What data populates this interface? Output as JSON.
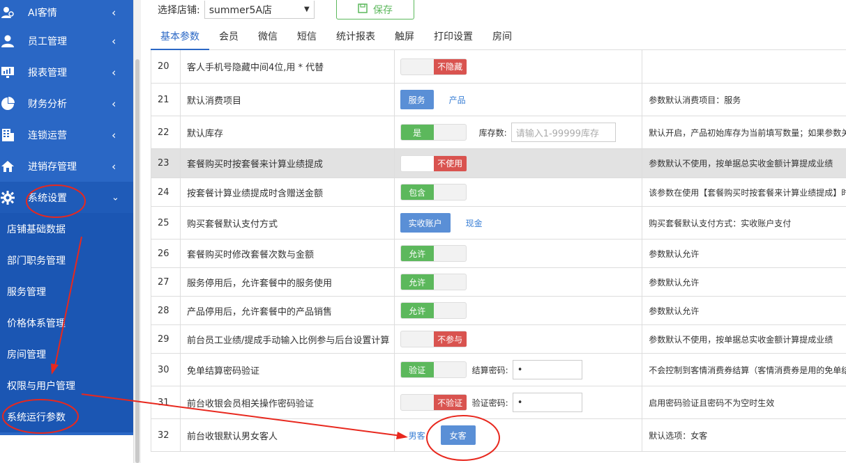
{
  "sidebar": {
    "items": [
      {
        "label": "AI客情",
        "icon": "users-icon"
      },
      {
        "label": "员工管理",
        "icon": "user-icon"
      },
      {
        "label": "报表管理",
        "icon": "monitor-icon"
      },
      {
        "label": "财务分析",
        "icon": "pie-chart-icon"
      },
      {
        "label": "连锁运营",
        "icon": "building-icon"
      },
      {
        "label": "进销存管理",
        "icon": "home-icon"
      },
      {
        "label": "系统设置",
        "icon": "gear-icon"
      }
    ],
    "sub_items": [
      "店铺基础数据",
      "部门职务管理",
      "服务管理",
      "价格体系管理",
      "房间管理",
      "权限与用户管理",
      "系统运行参数"
    ]
  },
  "toolbar": {
    "store_label": "选择店铺:",
    "store_value": "summer5A店",
    "save_label": "保存"
  },
  "tabs": [
    "基本参数",
    "会员",
    "微信",
    "短信",
    "统计报表",
    "触屏",
    "打印设置",
    "房间"
  ],
  "rows": [
    {
      "no": "20",
      "name": "客人手机号隐藏中间4位,用 * 代替",
      "toggle": "不隐藏",
      "desc": ""
    },
    {
      "no": "21",
      "name": "默认消费项目",
      "btn": "服务",
      "link": "产品",
      "desc": "参数默认消费项目：服务"
    },
    {
      "no": "22",
      "name": "默认库存",
      "toggle": "是",
      "field_label": "库存数:",
      "field_placeholder": "请输入1-99999库存",
      "desc": "默认开启，产品初始库存为当前填写数量；如果参数关"
    },
    {
      "no": "23",
      "name": "套餐购买时按套餐来计算业绩提成",
      "toggle": "不使用",
      "desc": "参数默认不使用，按单据总实收金额计算提成业绩"
    },
    {
      "no": "24",
      "name": "按套餐计算业绩提成时含赠送金额",
      "toggle": "包含",
      "desc": "该参数在使用【套餐购买时按套餐来计算业绩提成】时"
    },
    {
      "no": "25",
      "name": "购买套餐默认支付方式",
      "btn": "实收账户",
      "link": "现金",
      "desc": "购买套餐默认支付方式：实收账户支付"
    },
    {
      "no": "26",
      "name": "套餐购买时修改套餐次数与金额",
      "toggle": "允许",
      "desc": "参数默认允许"
    },
    {
      "no": "27",
      "name": "服务停用后，允许套餐中的服务使用",
      "toggle": "允许",
      "desc": "参数默认允许"
    },
    {
      "no": "28",
      "name": "产品停用后，允许套餐中的产品销售",
      "toggle": "允许",
      "desc": "参数默认允许"
    },
    {
      "no": "29",
      "name": "前台员工业绩/提成手动输入比例参与后台设置计算",
      "toggle": "不参与",
      "desc": "参数默认不使用，按单据总实收金额计算提成业绩"
    },
    {
      "no": "30",
      "name": "免单结算密码验证",
      "toggle": "验证",
      "field_label": "结算密码:",
      "field_value": "•",
      "desc": "不会控制到客情消费券结算（客情消费券是用的免单结"
    },
    {
      "no": "31",
      "name": "前台收银会员相关操作密码验证",
      "toggle": "不验证",
      "field_label": "验证密码:",
      "field_value": "•",
      "desc": "启用密码验证且密码不为空时生效"
    },
    {
      "no": "32",
      "name": "前台收银默认男女客人",
      "link_first": "男客",
      "btn_after": "女客",
      "desc": "默认选项：女客"
    }
  ],
  "colors": {
    "sidebar_bg": "#2a67c5",
    "accent": "#2a67c5",
    "toggle_on": "#5cb85c",
    "toggle_off": "#d9534f",
    "annotation": "#e8281e"
  }
}
